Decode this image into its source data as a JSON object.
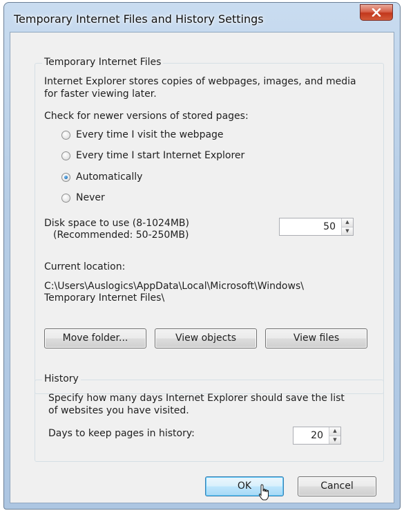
{
  "window": {
    "title": "Temporary Internet Files and History Settings",
    "close_icon": "close-x-icon"
  },
  "temp_files": {
    "legend": "Temporary Internet Files",
    "description_line1": "Internet Explorer stores copies of webpages, images, and media",
    "description_line2": "for faster viewing later.",
    "check_label": "Check for newer versions of stored pages:",
    "options": [
      {
        "label": "Every time I visit the webpage",
        "checked": false
      },
      {
        "label": "Every time I start Internet Explorer",
        "checked": false
      },
      {
        "label": "Automatically",
        "checked": true
      },
      {
        "label": "Never",
        "checked": false
      }
    ],
    "disk_label_line1": "Disk space to use (8-1024MB)",
    "disk_label_line2": "(Recommended: 50-250MB)",
    "disk_value": "50",
    "location_label": "Current location:",
    "location_line1": "C:\\Users\\Auslogics\\AppData\\Local\\Microsoft\\Windows\\",
    "location_line2": "Temporary Internet Files\\",
    "buttons": {
      "move_folder": "Move folder...",
      "view_objects": "View objects",
      "view_files": "View files"
    }
  },
  "history": {
    "legend": "History",
    "description_line1": "Specify how many days Internet Explorer should save the list",
    "description_line2": "of websites you have visited.",
    "days_label": "Days to keep pages in history:",
    "days_value": "20"
  },
  "footer": {
    "ok": "OK",
    "cancel": "Cancel"
  }
}
